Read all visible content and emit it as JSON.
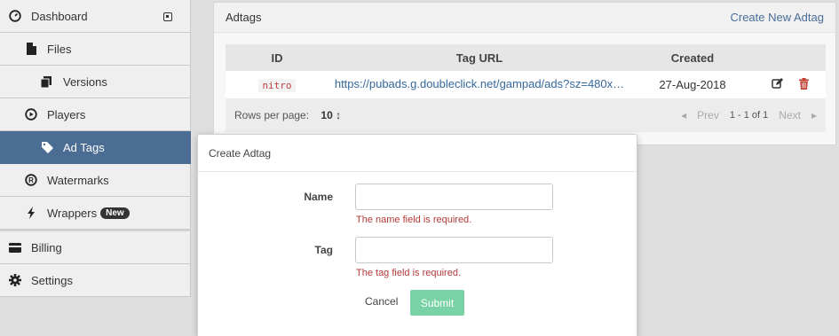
{
  "sidebar": {
    "dashboard": "Dashboard",
    "files": "Files",
    "versions": "Versions",
    "players": "Players",
    "ad_tags": "Ad Tags",
    "watermarks": "Watermarks",
    "wrappers": "Wrappers",
    "wrappers_badge": "New",
    "billing": "Billing",
    "settings": "Settings"
  },
  "panel": {
    "title": "Adtags",
    "create_link": "Create New Adtag",
    "columns": [
      "ID",
      "Tag URL",
      "Created"
    ],
    "rows": [
      {
        "id": "nitro",
        "url": "https://pubads.g.doubleclick.net/gampad/ads?sz=480x…",
        "created": "27-Aug-2018"
      }
    ],
    "footer": {
      "rows_per_page_label": "Rows per page:",
      "rows_per_page_value": "10",
      "prev": "Prev",
      "range": "1 - 1 of 1",
      "next": "Next"
    }
  },
  "modal": {
    "title": "Create Adtag",
    "name_label": "Name",
    "name_value": "",
    "name_error": "The name field is required.",
    "tag_label": "Tag",
    "tag_value": "",
    "tag_error": "The tag field is required.",
    "cancel": "Cancel",
    "submit": "Submit"
  },
  "colors": {
    "active_nav": "#4b6d93",
    "link": "#4a6e99",
    "error": "#b33a3a",
    "submit": "#79d2a6",
    "delete": "#c0392b"
  }
}
